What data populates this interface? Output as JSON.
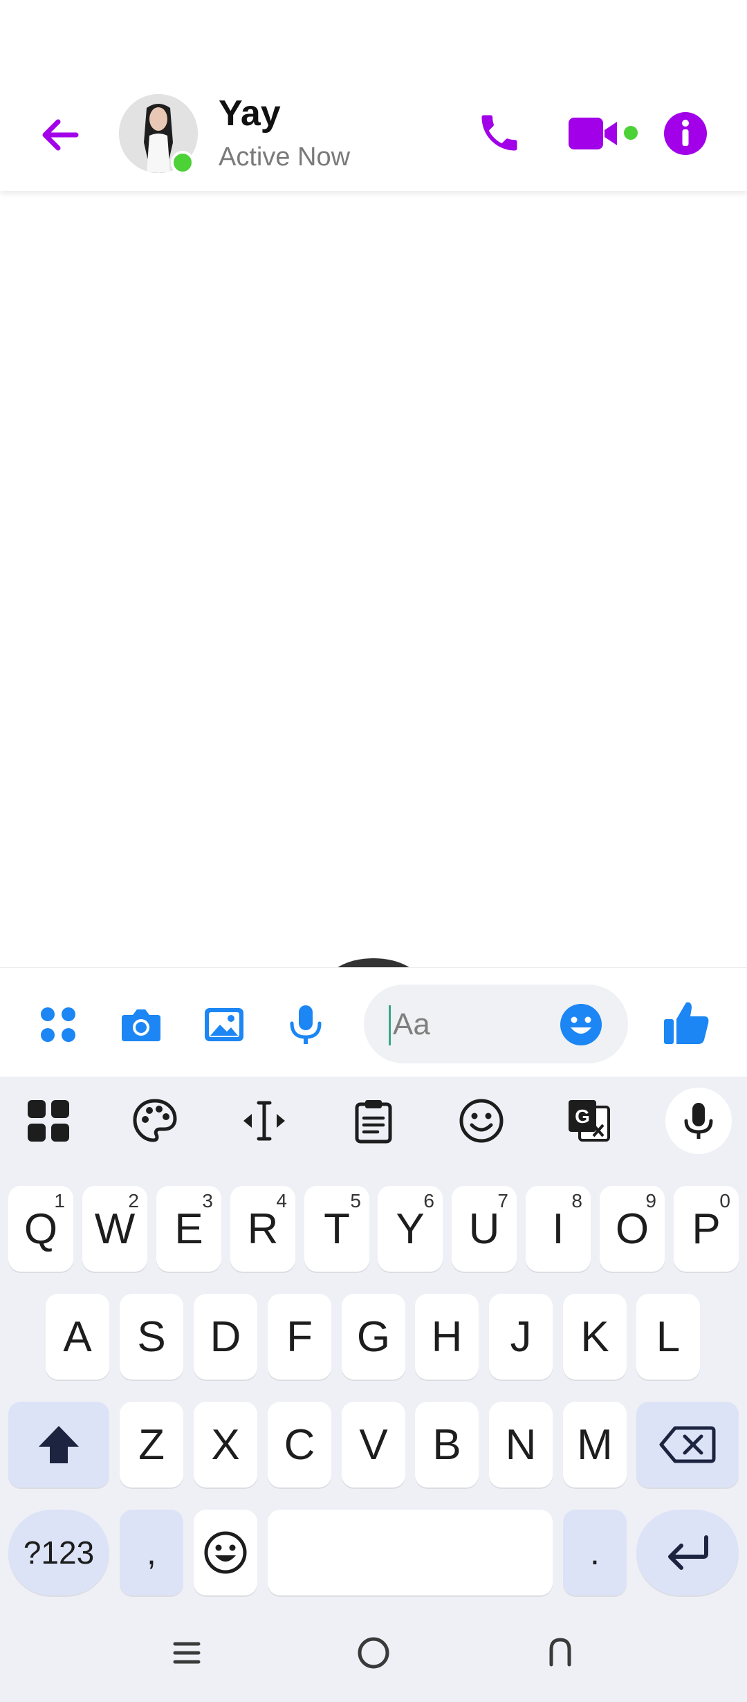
{
  "header": {
    "contact_name": "Yay",
    "contact_status": "Active Now",
    "icons": {
      "back": "back-arrow-icon",
      "call": "phone-icon",
      "video": "video-camera-icon",
      "info": "info-icon"
    }
  },
  "composer": {
    "placeholder": "Aa",
    "icons": [
      "apps-grid-icon",
      "camera-icon",
      "gallery-icon",
      "microphone-icon",
      "emoji-icon",
      "thumbs-up-icon"
    ]
  },
  "keyboard": {
    "toolbar": [
      "apps-grid-icon",
      "palette-icon",
      "cursor-move-icon",
      "clipboard-icon",
      "emoji-icon",
      "translate-icon",
      "microphone-icon"
    ],
    "row1": [
      {
        "label": "Q",
        "hint": "1"
      },
      {
        "label": "W",
        "hint": "2"
      },
      {
        "label": "E",
        "hint": "3"
      },
      {
        "label": "R",
        "hint": "4"
      },
      {
        "label": "T",
        "hint": "5"
      },
      {
        "label": "Y",
        "hint": "6"
      },
      {
        "label": "U",
        "hint": "7"
      },
      {
        "label": "I",
        "hint": "8"
      },
      {
        "label": "O",
        "hint": "9"
      },
      {
        "label": "P",
        "hint": "0"
      }
    ],
    "row2": [
      "A",
      "S",
      "D",
      "F",
      "G",
      "H",
      "J",
      "K",
      "L"
    ],
    "row3": [
      "Z",
      "X",
      "C",
      "V",
      "B",
      "N",
      "M"
    ],
    "symbols_label": "?123",
    "comma_label": ",",
    "period_label": "."
  },
  "nav_bar": {
    "icons": [
      "recent-apps-icon",
      "home-icon",
      "back-icon"
    ]
  },
  "colors": {
    "accent_purple": "#a100e8",
    "messenger_blue": "#1b86f4",
    "online_green": "#4cd137",
    "keyboard_bg": "#eef0f6",
    "function_key": "#dde3f7"
  }
}
